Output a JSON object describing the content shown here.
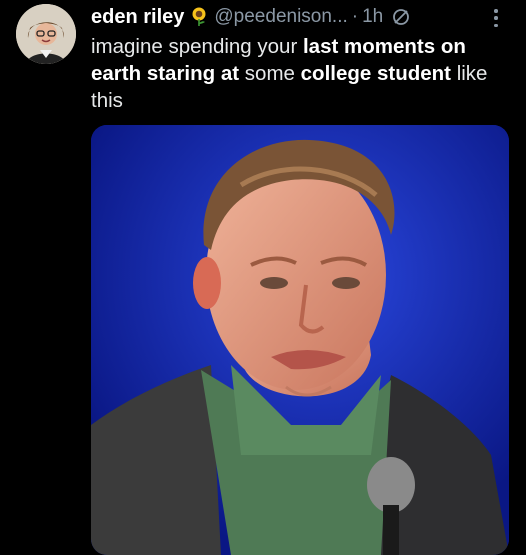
{
  "tweet": {
    "display_name": "eden riley",
    "handle": "@peedenison...",
    "separator": "·",
    "time": "1h",
    "text_parts": [
      {
        "text": "imagine spending your ",
        "bold": false
      },
      {
        "text": "last moments on earth staring at",
        "bold": true
      },
      {
        "text": " some ",
        "bold": false
      },
      {
        "text": "college student",
        "bold": true
      },
      {
        "text": " like this",
        "bold": false
      }
    ]
  },
  "icons": {
    "name_emoji": "sunflower-icon",
    "status": "circle-slash-icon",
    "menu": "more-vertical-icon"
  },
  "colors": {
    "background": "#000000",
    "text": "#e7e9ea",
    "muted": "#8b98a5",
    "stage_blue": "#1c37cf"
  }
}
